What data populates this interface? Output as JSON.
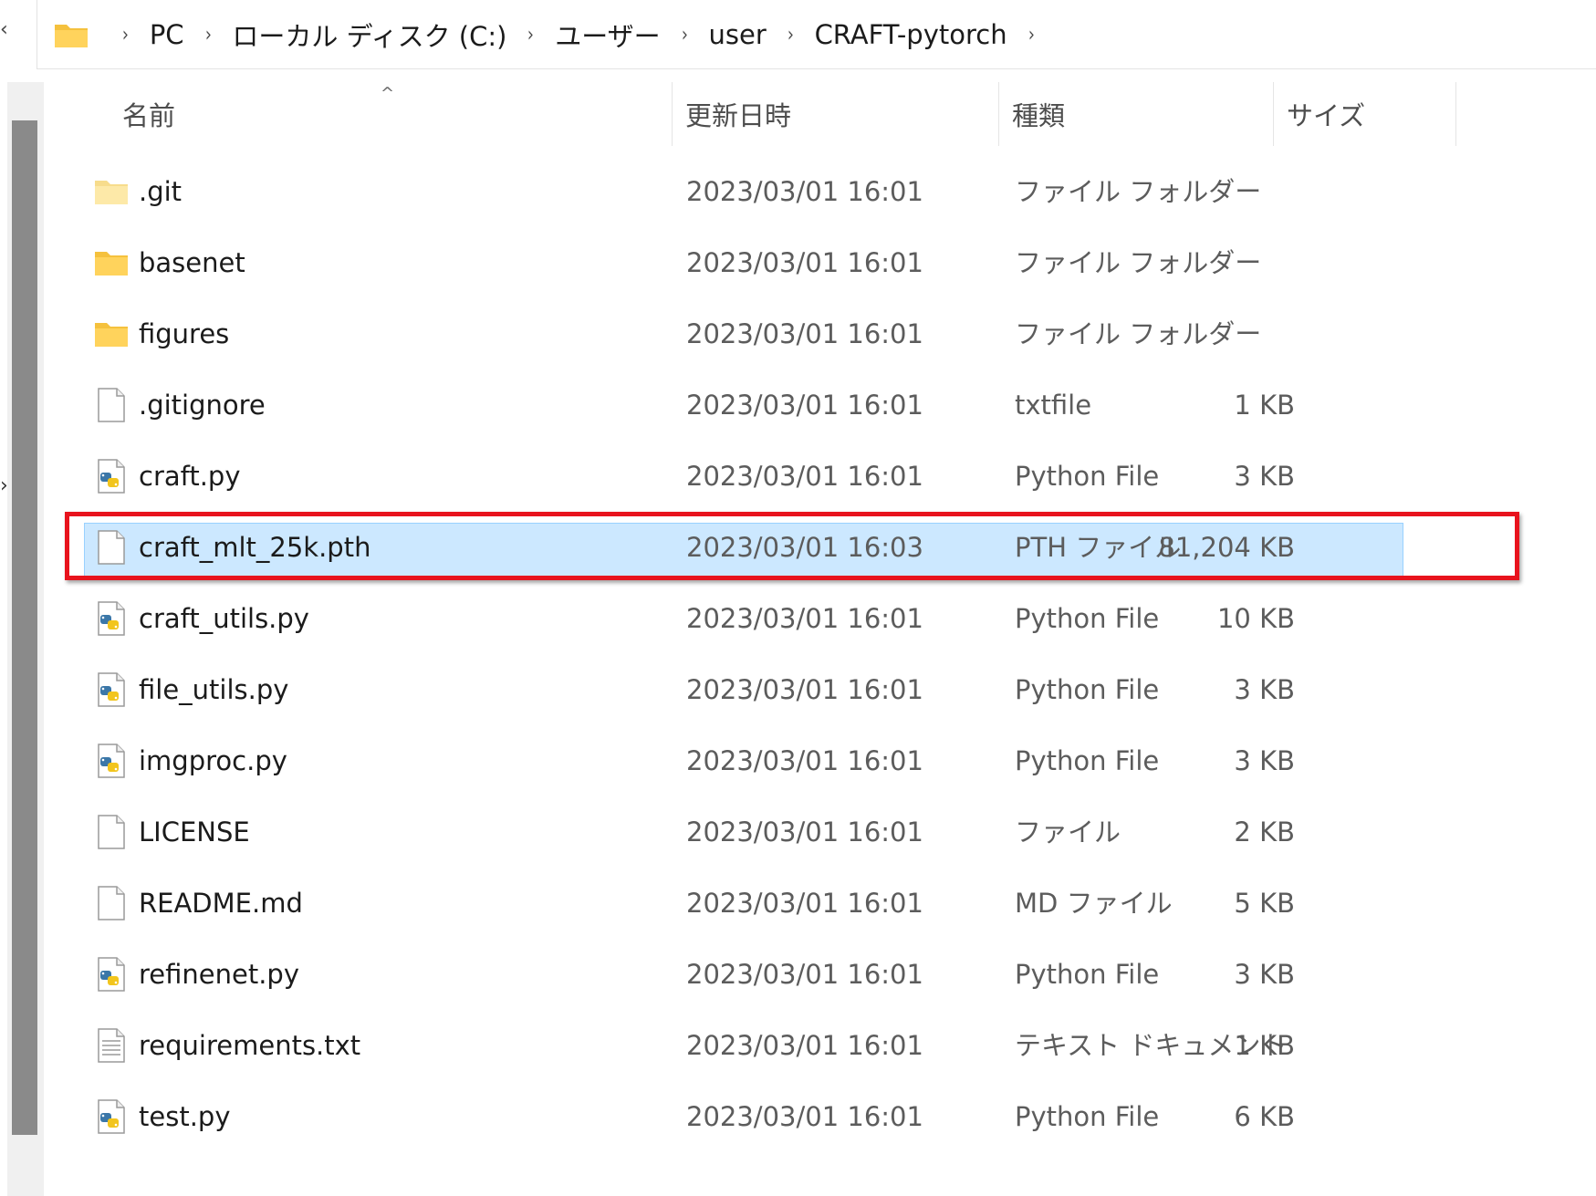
{
  "breadcrumb": [
    "PC",
    "ローカル ディスク (C:)",
    "ユーザー",
    "user",
    "CRAFT-pytorch"
  ],
  "columns": {
    "name": "名前",
    "date": "更新日時",
    "type": "種類",
    "size": "サイズ"
  },
  "files": [
    {
      "name": ".git",
      "date": "2023/03/01 16:01",
      "type": "ファイル フォルダー",
      "size": "",
      "icon": "folder-light"
    },
    {
      "name": "basenet",
      "date": "2023/03/01 16:01",
      "type": "ファイル フォルダー",
      "size": "",
      "icon": "folder"
    },
    {
      "name": "figures",
      "date": "2023/03/01 16:01",
      "type": "ファイル フォルダー",
      "size": "",
      "icon": "folder"
    },
    {
      "name": ".gitignore",
      "date": "2023/03/01 16:01",
      "type": "txtfile",
      "size": "1 KB",
      "icon": "file"
    },
    {
      "name": "craft.py",
      "date": "2023/03/01 16:01",
      "type": "Python File",
      "size": "3 KB",
      "icon": "python"
    },
    {
      "name": "craft_mlt_25k.pth",
      "date": "2023/03/01 16:03",
      "type": "PTH ファイル",
      "size": "81,204 KB",
      "icon": "file",
      "selected": true
    },
    {
      "name": "craft_utils.py",
      "date": "2023/03/01 16:01",
      "type": "Python File",
      "size": "10 KB",
      "icon": "python"
    },
    {
      "name": "file_utils.py",
      "date": "2023/03/01 16:01",
      "type": "Python File",
      "size": "3 KB",
      "icon": "python"
    },
    {
      "name": "imgproc.py",
      "date": "2023/03/01 16:01",
      "type": "Python File",
      "size": "3 KB",
      "icon": "python"
    },
    {
      "name": "LICENSE",
      "date": "2023/03/01 16:01",
      "type": "ファイル",
      "size": "2 KB",
      "icon": "file"
    },
    {
      "name": "README.md",
      "date": "2023/03/01 16:01",
      "type": "MD ファイル",
      "size": "5 KB",
      "icon": "file"
    },
    {
      "name": "refinenet.py",
      "date": "2023/03/01 16:01",
      "type": "Python File",
      "size": "3 KB",
      "icon": "python"
    },
    {
      "name": "requirements.txt",
      "date": "2023/03/01 16:01",
      "type": "テキスト ドキュメント",
      "size": "1 KB",
      "icon": "text"
    },
    {
      "name": "test.py",
      "date": "2023/03/01 16:01",
      "type": "Python File",
      "size": "6 KB",
      "icon": "python"
    }
  ],
  "colors": {
    "selection": "#cce8ff",
    "highlight": "#e8131d",
    "folder": "#ffd35c"
  }
}
